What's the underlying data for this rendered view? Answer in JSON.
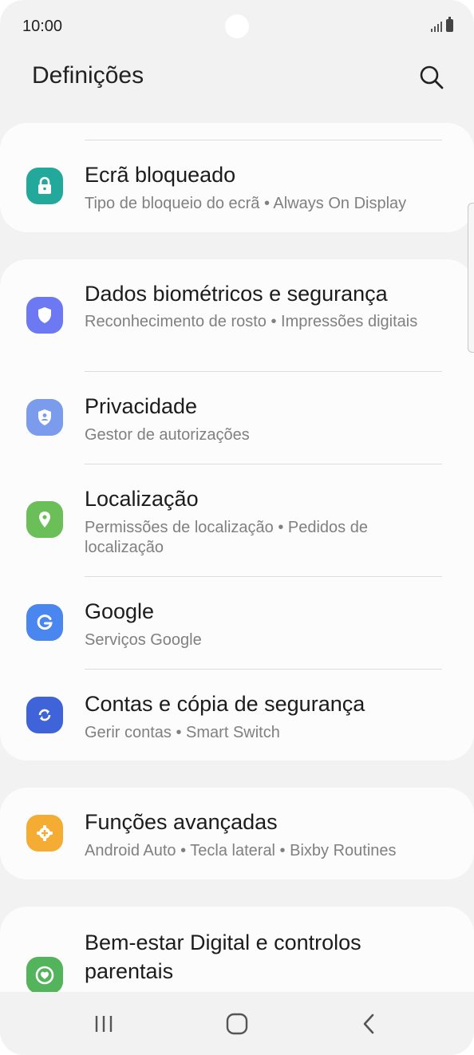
{
  "status": {
    "time": "10:00"
  },
  "header": {
    "title": "Definições"
  },
  "items": [
    {
      "label": "Ecrã bloqueado",
      "sub": "Tipo de bloqueio do ecrã  •  Always On Display",
      "icon": "lock-icon",
      "color": "#22a99b"
    },
    {
      "label": "Dados biométricos e segurança",
      "sub": "Reconhecimento de rosto  •  Impressões digitais",
      "icon": "shield-icon",
      "color": "#6d79f2"
    },
    {
      "label": "Privacidade",
      "sub": "Gestor de autorizações",
      "icon": "privacy-icon",
      "color": "#7b9cec"
    },
    {
      "label": "Localização",
      "sub": "Permissões de localização  •  Pedidos de localização",
      "icon": "location-pin-icon",
      "color": "#6bbf59"
    },
    {
      "label": "Google",
      "sub": "Serviços Google",
      "icon": "google-icon",
      "color": "#4a86ef"
    },
    {
      "label": "Contas e cópia de segurança",
      "sub": "Gerir contas  •  Smart Switch",
      "icon": "sync-icon",
      "color": "#3f63d8"
    },
    {
      "label": "Funções avançadas",
      "sub": "Android Auto  •  Tecla lateral  •  Bixby Routines",
      "icon": "gear-plus-icon",
      "color": "#f5ac33"
    },
    {
      "label": "Bem-estar Digital e controlos parentais",
      "sub": "",
      "icon": "heart-circle-icon",
      "color": "#54b45c"
    }
  ]
}
